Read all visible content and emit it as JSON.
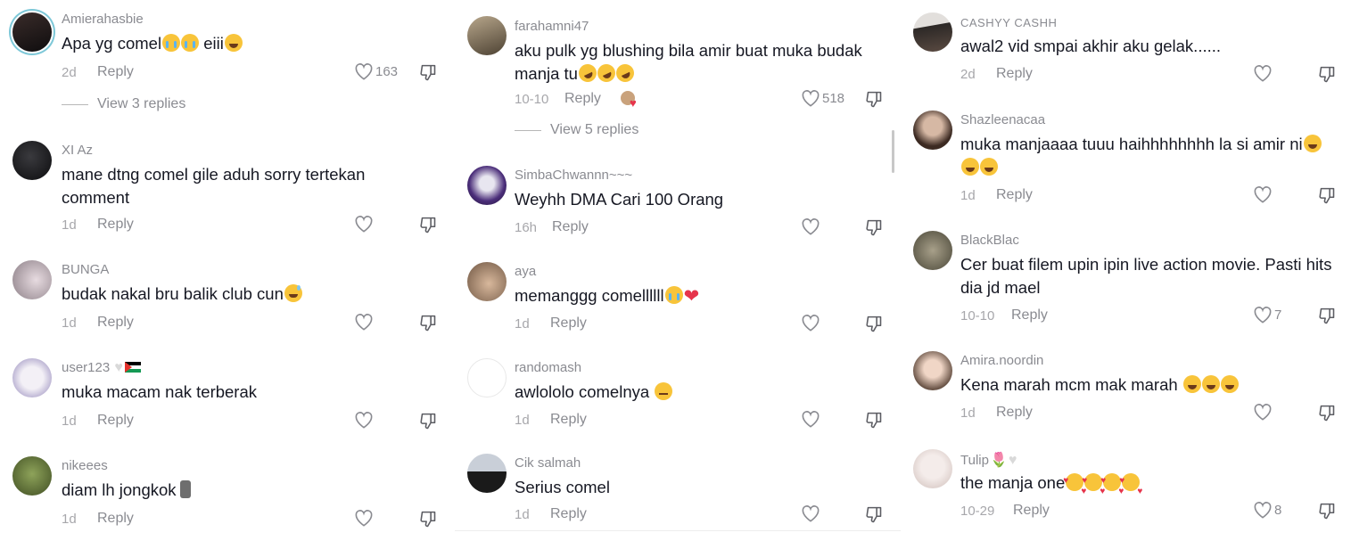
{
  "panels": [
    {
      "comments": [
        {
          "username": "Amierahasbie",
          "text": "Apa yg comel",
          "emojis": [
            "face-cry",
            "face-cry"
          ],
          "text2": " eiii",
          "emojis2": [
            "face-laugh"
          ],
          "date": "2d",
          "reply": "Reply",
          "likes": "163",
          "view_replies": "View 3 replies"
        },
        {
          "username": "XI Az",
          "text": "mane dtng comel gile aduh sorry tertekan comment",
          "date": "1d",
          "reply": "Reply",
          "likes": ""
        },
        {
          "username": "BUNGA",
          "text": "budak nakal bru balik club cun",
          "emojis": [
            "face-sweat"
          ],
          "date": "1d",
          "reply": "Reply",
          "likes": ""
        },
        {
          "username": "user123",
          "text": "muka macam nak terberak",
          "date": "1d",
          "reply": "Reply",
          "likes": ""
        },
        {
          "username": "nikeees",
          "text": "diam lh jongkok",
          "emojis": [
            "moai"
          ],
          "date": "1d",
          "reply": "Reply",
          "likes": ""
        }
      ]
    },
    {
      "comments": [
        {
          "username": "farahamni47",
          "text": "aku pulk yg blushing bila amir buat muka budak manja tu",
          "emojis": [
            "face-rofl",
            "face-rofl",
            "face-rofl"
          ],
          "date": "10-10",
          "reply": "Reply",
          "likes": "518",
          "view_replies": "View 5 replies"
        },
        {
          "username": "SimbaChwannn~~~",
          "text": "Weyhh DMA Cari 100 Orang",
          "date": "16h",
          "reply": "Reply",
          "likes": ""
        },
        {
          "username": "aya",
          "text": "memanggg comellllll",
          "emojis": [
            "face-cry",
            "heart"
          ],
          "date": "1d",
          "reply": "Reply",
          "likes": ""
        },
        {
          "username": "randomash",
          "text": "awlololo comelnya ",
          "emojis": [
            "face-neutral"
          ],
          "date": "1d",
          "reply": "Reply",
          "likes": ""
        },
        {
          "username": "Cik salmah",
          "text": "Serius comel",
          "date": "1d",
          "reply": "Reply",
          "likes": ""
        }
      ]
    },
    {
      "comments": [
        {
          "username": "CASHYY CASHH",
          "text": "awal2 vid smpai akhir aku gelak......",
          "date": "2d",
          "reply": "Reply",
          "likes": ""
        },
        {
          "username": "Shazleenacaa",
          "text": "muka manjaaaa tuuu haihhhhhhhh la si amir ni",
          "emojis": [
            "face-laugh",
            "face-laugh",
            "face-laugh"
          ],
          "date": "1d",
          "reply": "Reply",
          "likes": ""
        },
        {
          "username": "BlackBlac",
          "text": "Cer buat filem upin ipin live action movie. Pasti hits dia jd mael",
          "date": "10-10",
          "reply": "Reply",
          "likes": "7"
        },
        {
          "username": "Amira.noordin",
          "text": "Kena marah mcm mak marah ",
          "emojis": [
            "face-laugh",
            "face-laugh",
            "face-laugh"
          ],
          "date": "1d",
          "reply": "Reply",
          "likes": ""
        },
        {
          "username": "Tulip",
          "text": "the manja one",
          "emojis": [
            "face-love",
            "face-love",
            "face-love",
            "face-love"
          ],
          "date": "10-29",
          "reply": "Reply",
          "likes": "8"
        }
      ]
    }
  ],
  "icons": {
    "like": "heart-outline-icon",
    "dislike": "thumbs-down-icon"
  },
  "colors": {
    "text": "#161823",
    "muted": "#8a8b91",
    "date": "#a7a7ab",
    "ring": "#7ec8d8"
  }
}
